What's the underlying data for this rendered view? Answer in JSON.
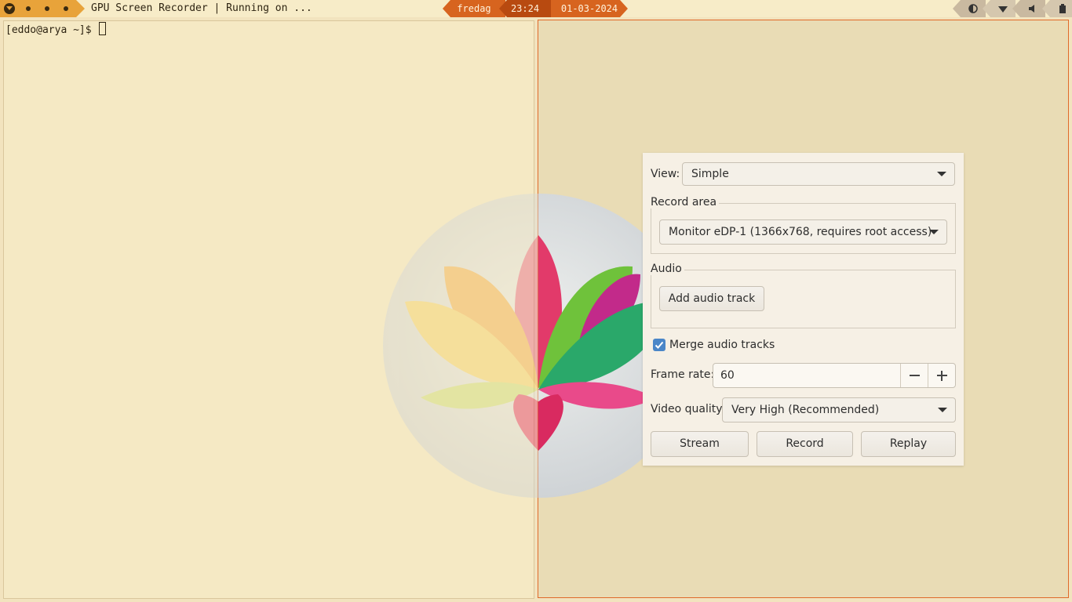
{
  "topbar": {
    "window_title": "GPU Screen Recorder | Running on ...",
    "clock": {
      "day": "fredag",
      "time": "23:24",
      "date": "01-03-2024"
    },
    "tray_icons": [
      "contrast-icon",
      "wifi-icon",
      "volume-icon",
      "battery-icon"
    ],
    "colors": {
      "workspace": "#e8a33a",
      "clock_accent": "#d7641f",
      "clock_dark": "#b84a10",
      "tray": "#c9b9a0"
    }
  },
  "terminal": {
    "prompt": "[eddo@arya ~]$ "
  },
  "dialog": {
    "view_label": "View:",
    "view_value": "Simple",
    "record_area_title": "Record area",
    "record_area_value": "Monitor eDP-1 (1366x768, requires root access)",
    "audio_title": "Audio",
    "add_audio_label": "Add audio track",
    "merge_label": "Merge audio tracks",
    "merge_checked": true,
    "frame_rate_label": "Frame rate:",
    "frame_rate_value": "60",
    "video_quality_label": "Video quality:",
    "video_quality_value": "Very High (Recommended)",
    "stream_label": "Stream",
    "record_label": "Record",
    "replay_label": "Replay"
  }
}
